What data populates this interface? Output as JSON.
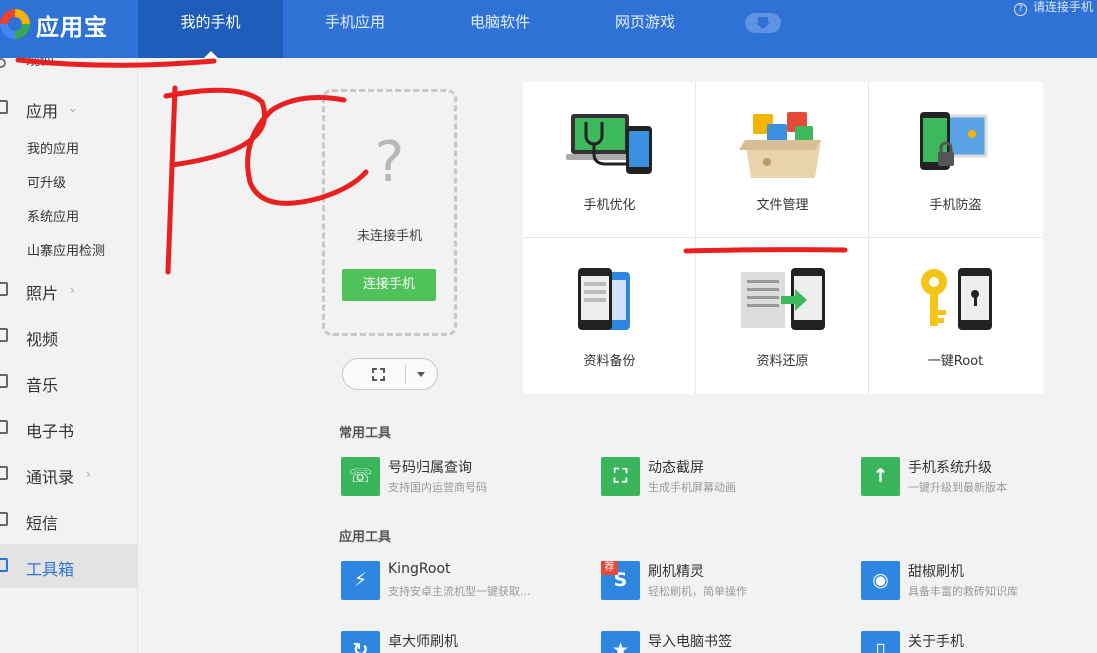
{
  "app": {
    "title": "应用宝",
    "connect_hint": "请连接手机"
  },
  "nav": {
    "tabs": [
      {
        "label": "我的手机"
      },
      {
        "label": "手机应用"
      },
      {
        "label": "电脑软件"
      },
      {
        "label": "网页游戏"
      }
    ]
  },
  "sidebar": {
    "top_partial_label": "观仙",
    "items": [
      {
        "label": "应用"
      },
      {
        "label": "照片"
      },
      {
        "label": "视频"
      },
      {
        "label": "音乐"
      },
      {
        "label": "电子书"
      },
      {
        "label": "通讯录"
      },
      {
        "label": "短信"
      },
      {
        "label": "工具箱"
      }
    ],
    "app_subitems": [
      "我的应用",
      "可升级",
      "系统应用",
      "山寨应用检测"
    ]
  },
  "phone": {
    "question_mark": "?",
    "status": "未连接手机",
    "connect_label": "连接手机"
  },
  "features": [
    {
      "label": "手机优化"
    },
    {
      "label": "文件管理"
    },
    {
      "label": "手机防盗"
    },
    {
      "label": "资料备份"
    },
    {
      "label": "资料还原"
    },
    {
      "label": "一键Root"
    }
  ],
  "sections": {
    "common_tools": "常用工具",
    "app_tools": "应用工具"
  },
  "common_tools": [
    {
      "name": "号码归属查询",
      "desc": "支持国内运营商号码",
      "color": "#3bb55b"
    },
    {
      "name": "动态截屏",
      "desc": "生成手机屏幕动画",
      "color": "#3bb55b"
    },
    {
      "name": "手机系统升级",
      "desc": "一键升级到最新版本",
      "color": "#3bb55b"
    }
  ],
  "app_tools": [
    {
      "name": "KingRoot",
      "desc": "支持安卓主流机型一键获取...",
      "color": "#2e86e0"
    },
    {
      "name": "刷机精灵",
      "desc": "轻松刷机，简单操作",
      "color": "#2e86e0",
      "badge": "荐"
    },
    {
      "name": "甜椒刷机",
      "desc": "具备丰富的救砖知识库",
      "color": "#2e86e0"
    },
    {
      "name": "卓大师刷机",
      "color": "#2e86e0"
    },
    {
      "name": "导入电脑书签",
      "color": "#2e86e0"
    },
    {
      "name": "关于手机",
      "color": "#2e86e0"
    }
  ],
  "annotation": {
    "text": "PC",
    "color": "#e82020"
  }
}
